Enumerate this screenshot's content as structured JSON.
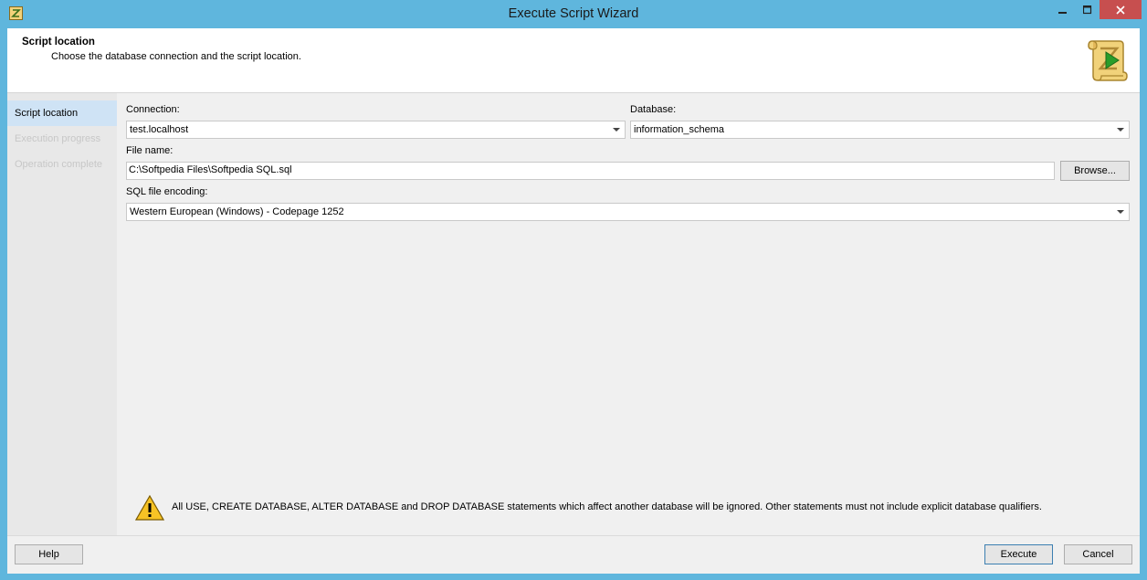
{
  "window": {
    "title": "Execute Script Wizard"
  },
  "header": {
    "title": "Script location",
    "subtitle": "Choose the database connection and the script location."
  },
  "sidebar": {
    "steps": [
      {
        "label": "Script location",
        "state": "active"
      },
      {
        "label": "Execution progress",
        "state": "inactive"
      },
      {
        "label": "Operation complete",
        "state": "inactive"
      }
    ]
  },
  "form": {
    "connection_label": "Connection:",
    "connection_value": "test.localhost",
    "database_label": "Database:",
    "database_value": "information_schema",
    "filename_label": "File name:",
    "filename_value": "C:\\Softpedia Files\\Softpedia SQL.sql",
    "browse_label": "Browse...",
    "encoding_label": "SQL file encoding:",
    "encoding_value": "Western European (Windows) - Codepage 1252"
  },
  "warning": {
    "text": "All USE, CREATE DATABASE, ALTER DATABASE and DROP DATABASE statements which affect another database will be ignored. Other statements must not include explicit database qualifiers."
  },
  "footer": {
    "help_label": "Help",
    "execute_label": "Execute",
    "cancel_label": "Cancel"
  },
  "colors": {
    "titlebar": "#5fb6dd",
    "close_button": "#c74f4f",
    "active_step": "#cfe3f5",
    "primary_border": "#3c7fb1"
  },
  "icons": {
    "app": "execute-script-icon",
    "header": "scroll-play-icon",
    "warning": "warning-triangle-icon"
  }
}
